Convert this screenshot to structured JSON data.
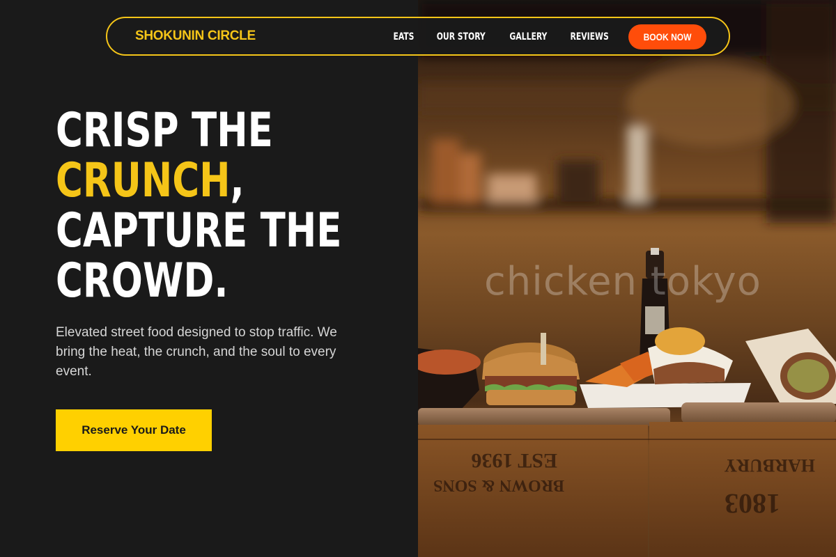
{
  "brand": {
    "name": "SHOKUNIN CIRCLE"
  },
  "nav": {
    "items": [
      {
        "label": "EATS"
      },
      {
        "label": "OUR STORY"
      },
      {
        "label": "GALLERY"
      },
      {
        "label": "REVIEWS"
      }
    ],
    "cta_label": "BOOK NOW"
  },
  "hero": {
    "line1": "CRISP THE",
    "line2_accent": "CRUNCH",
    "line2_rest": ",",
    "line3": "CAPTURE THE",
    "line4": "CROWD.",
    "subtext": "Elevated street food designed to stop traffic. We bring the heat, the crunch, and the soul to every event.",
    "cta_label": "Reserve Your Date"
  },
  "photo": {
    "watermark": "chicken tokyo",
    "crate_text_left": "EST 1936",
    "crate_text_right": "1803"
  },
  "colors": {
    "accent_yellow": "#f5c518",
    "cta_yellow": "#ffd000",
    "book_orange": "#ff4d0a",
    "background": "#1a1a1a"
  }
}
